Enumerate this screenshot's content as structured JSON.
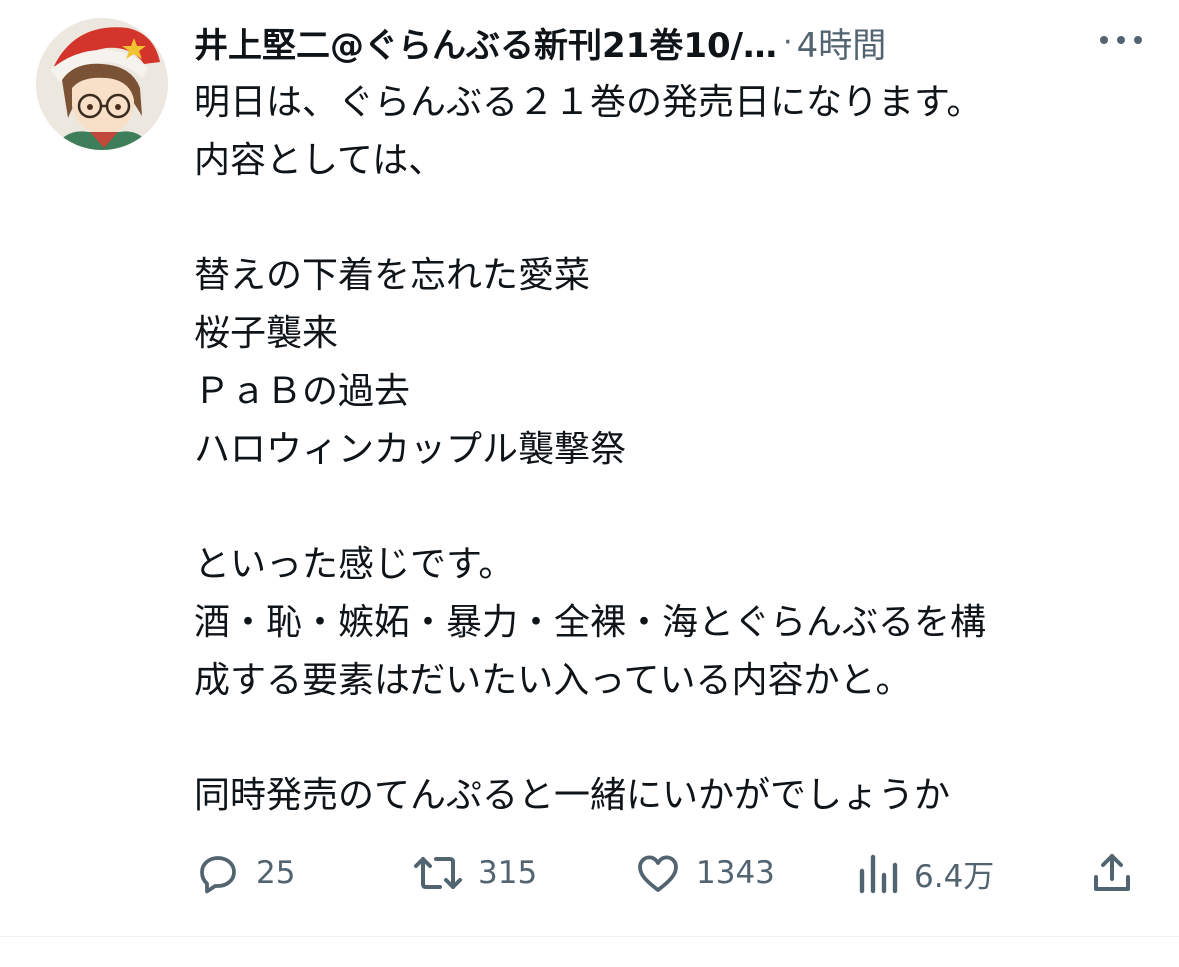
{
  "tweet": {
    "author": "井上堅二@ぐらんぶる新刊21巻10/…",
    "separator": "·",
    "time": "4時間",
    "lines": [
      "明日は、ぐらんぶる２１巻の発売日になります。",
      "内容としては、",
      "",
      "替えの下着を忘れた愛菜",
      "桜子襲来",
      "ＰａＢの過去",
      "ハロウィンカップル襲撃祭",
      "",
      "といった感じです。",
      "酒・恥・嫉妬・暴力・全裸・海とぐらんぶるを構",
      "成する要素はだいたい入っている内容かと。",
      "",
      "同時発売のてんぷると一緒にいかがでしょうか"
    ]
  },
  "actions": {
    "replies": "25",
    "reposts": "315",
    "likes": "1343",
    "views": "6.4万"
  },
  "icons": {
    "avatar": "avatar-image",
    "more": "more-options-icon",
    "reply": "reply-icon",
    "repost": "repost-icon",
    "like": "heart-icon",
    "views": "views-chart-icon",
    "share": "share-icon"
  },
  "colors": {
    "text": "#0f1419",
    "secondary": "#536471",
    "divider": "#eff3f4"
  }
}
